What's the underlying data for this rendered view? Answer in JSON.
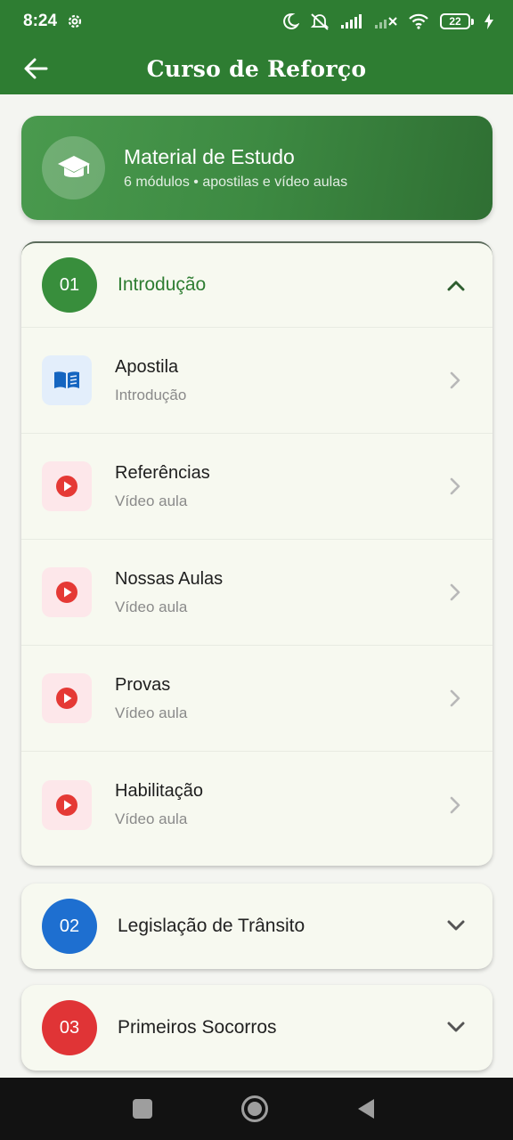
{
  "status_bar": {
    "time": "8:24",
    "battery_level": "22"
  },
  "app_bar": {
    "title": "Curso de Reforço"
  },
  "banner": {
    "title": "Material de Estudo",
    "subtitle": "6 módulos • apostilas e vídeo aulas",
    "icon": "graduation-cap-icon"
  },
  "modules": [
    {
      "number": "01",
      "title": "Introdução",
      "color": "#388e3c",
      "expanded": true,
      "lessons": [
        {
          "title": "Apostila",
          "subtitle": "Introdução",
          "icon": "book-icon"
        },
        {
          "title": "Referências",
          "subtitle": "Vídeo aula",
          "icon": "play-icon"
        },
        {
          "title": "Nossas Aulas",
          "subtitle": "Vídeo aula",
          "icon": "play-icon"
        },
        {
          "title": "Provas",
          "subtitle": "Vídeo aula",
          "icon": "play-icon"
        },
        {
          "title": "Habilitação",
          "subtitle": "Vídeo aula",
          "icon": "play-icon"
        }
      ]
    },
    {
      "number": "02",
      "title": "Legislação de Trânsito",
      "color": "#1e6fd0",
      "expanded": false
    },
    {
      "number": "03",
      "title": "Primeiros Socorros",
      "color": "#e03436",
      "expanded": false
    }
  ],
  "colors": {
    "primary": "#2e7d32",
    "video_red": "#e53935",
    "doc_blue": "#1565c0"
  }
}
